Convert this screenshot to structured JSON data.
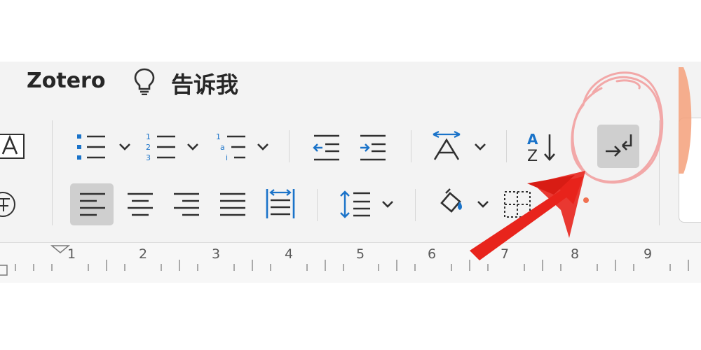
{
  "tabs": {
    "zotero": "Zotero",
    "tell_me": "告诉我"
  },
  "ruler": {
    "numbers": [
      "1",
      "2",
      "3",
      "4",
      "5",
      "6",
      "7",
      "8",
      "9"
    ]
  },
  "colors": {
    "ribbon_bg": "#f3f3f3",
    "pressed_button": "#cfcfcf",
    "icon_blue": "#1a73c9",
    "annotation_red": "#e8241c",
    "annotation_pink": "#f2a8a8"
  },
  "icons": [
    "text-box-icon",
    "character-border-icon",
    "bullets-icon",
    "numbering-icon",
    "multilevel-list-icon",
    "decrease-indent-icon",
    "increase-indent-icon",
    "asian-layout-icon",
    "sort-icon",
    "line-break-icon",
    "align-left-icon",
    "align-center-icon",
    "align-right-icon",
    "justify-icon",
    "distributed-icon",
    "line-spacing-icon",
    "shading-icon",
    "borders-icon",
    "lightbulb-icon"
  ],
  "state": {
    "align_left_active": true,
    "line_break_active": true
  }
}
